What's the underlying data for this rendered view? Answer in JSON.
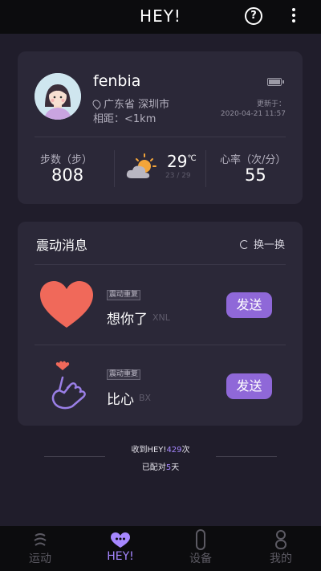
{
  "header": {
    "title": "HEY!",
    "help_icon_glyph": "?"
  },
  "profile": {
    "name": "fenbia",
    "location": "广东省 深圳市",
    "distance": "相距：<1km",
    "updated_label": "更新于：",
    "updated_time": "2020-04-21 11:57",
    "battery_level": 1.0
  },
  "stats": {
    "steps_label": "步数（步）",
    "steps_value": "808",
    "temperature": "29",
    "temperature_unit": "℃",
    "temperature_range": "23 / 29",
    "heart_rate_label": "心率（次/分）",
    "heart_rate_value": "55"
  },
  "messages": {
    "title": "震动消息",
    "refresh_label": "换一换",
    "items": [
      {
        "tag": "震动重复",
        "text": "想你了",
        "code": "XNL",
        "send_label": "发送",
        "icon": "heart-icon",
        "color": "#f0695a"
      },
      {
        "tag": "震动重复",
        "text": "比心",
        "code": "BX",
        "send_label": "发送",
        "icon": "finger-heart-icon",
        "color": "#9a7fe6"
      }
    ]
  },
  "footer": {
    "received_prefix": "收到HEY!",
    "received_count": "429",
    "received_suffix": "次",
    "paired_prefix": "已配对",
    "paired_days": "5",
    "paired_suffix": "天"
  },
  "nav": [
    {
      "label": "运动",
      "icon": "activity-icon",
      "active": false
    },
    {
      "label": "HEY!",
      "icon": "hey-chat-icon",
      "active": true
    },
    {
      "label": "设备",
      "icon": "band-icon",
      "active": false
    },
    {
      "label": "我的",
      "icon": "profile-icon",
      "active": false
    }
  ],
  "colors": {
    "accent": "#8f68d8",
    "highlight": "#a687ff",
    "background": "#201d2b",
    "card": "#2b2838"
  }
}
